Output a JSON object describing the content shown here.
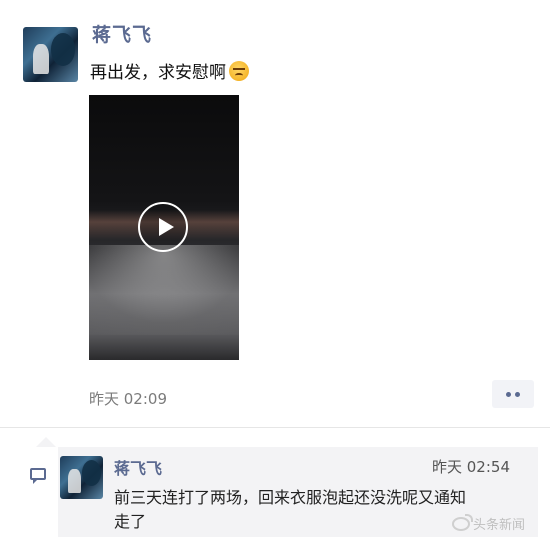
{
  "post": {
    "author": "蒋飞飞",
    "text": "再出发，求安慰啊",
    "emoji_icon": "sad-face-emoji",
    "time": "昨天 02:09",
    "video_icon": "play-icon"
  },
  "actions": {
    "more_icon": "more-dots-icon"
  },
  "comment": {
    "icon": "comment-icon",
    "author": "蒋飞飞",
    "time": "昨天 02:54",
    "text": "前三天连打了两场，回来衣服泡起还没洗呢又通知走了"
  },
  "watermark": {
    "icon": "weibo-icon",
    "text": "头条新闻"
  },
  "colors": {
    "author_name": "#5b6a91",
    "background": "#ffffff",
    "comment_bg": "#f3f3f5"
  }
}
